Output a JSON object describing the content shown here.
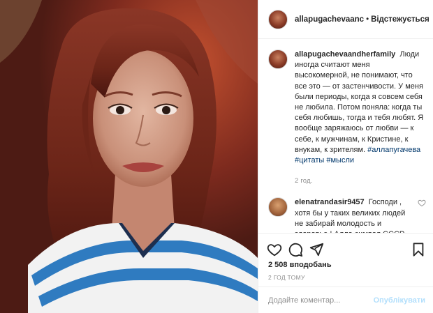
{
  "header": {
    "username": "allapugachevaanc",
    "separator": "•",
    "follow_label": "Відстежується"
  },
  "caption": {
    "username": "allapugachevaandherfamily",
    "text": "Люди иногда считают меня высокомерной, не понимают, что все это — от застенчивости. У меня были периоды, когда я совсем себя не любила. Потом поняла: когда ты себя любишь, тогда и тебя любят. Я вообще заряжаюсь от любви — к себе, к мужчинам, к Кристине, к внукам, к зрителям.",
    "hashtags": [
      "#аллапугачева",
      "#цитаты",
      "#мысли"
    ],
    "time": "2 год."
  },
  "comment": {
    "username": "elenatrandasir9457",
    "text": "Господи , хотя бы у таких великих людей не забирай молодость и здоровье ! Алла символ СССР , нашей молодости и счастья !🙌 🙈🙈🙊✨"
  },
  "actions": {
    "like_icon": "heart-icon",
    "comment_icon": "comment-icon",
    "share_icon": "paper-plane-icon",
    "save_icon": "bookmark-icon"
  },
  "likes": "2 508 вподобань",
  "post_time": "2 ГОД ТОМУ",
  "add_comment": {
    "placeholder": "Додайте коментар...",
    "publish_label": "Опублікувати"
  },
  "colors": {
    "hashtag": "#00376b",
    "publish_disabled": "#b2dffc",
    "secondary_text": "#8e8e8e",
    "border": "#efefef"
  }
}
